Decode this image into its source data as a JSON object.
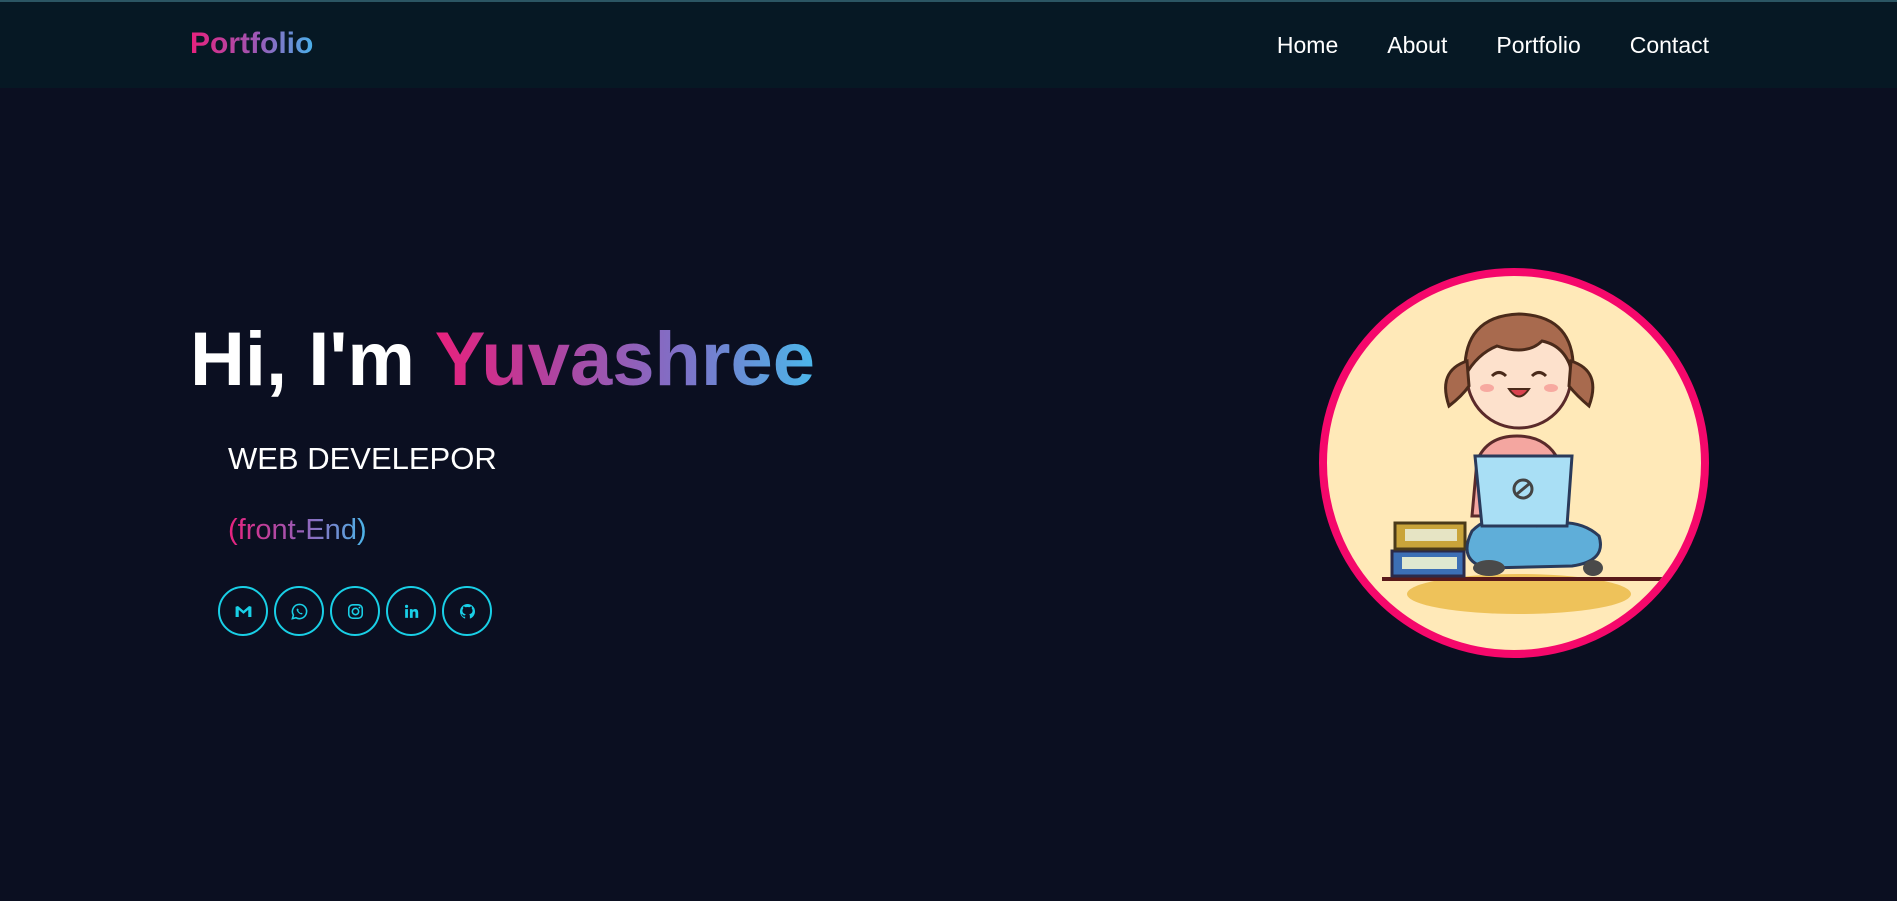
{
  "header": {
    "logo": "Portfolio",
    "nav": [
      {
        "label": "Home"
      },
      {
        "label": "About"
      },
      {
        "label": "Portfolio"
      },
      {
        "label": "Contact"
      }
    ]
  },
  "hero": {
    "greeting": "Hi, I'm ",
    "name": "Yuvashree",
    "role": "WEB DEVELEPOR",
    "sub_role": "(front-End)"
  },
  "socials": [
    {
      "icon": "gmail-icon"
    },
    {
      "icon": "whatsapp-icon"
    },
    {
      "icon": "instagram-icon"
    },
    {
      "icon": "linkedin-icon"
    },
    {
      "icon": "github-icon"
    }
  ],
  "colors": {
    "background": "#0b0f21",
    "header": "#061824",
    "accent_pink": "#e8217d",
    "accent_blue": "#4bb6ea",
    "social_ring": "#19cfe6",
    "avatar_ring": "#f5086b",
    "avatar_bg": "#ffe9b8"
  }
}
